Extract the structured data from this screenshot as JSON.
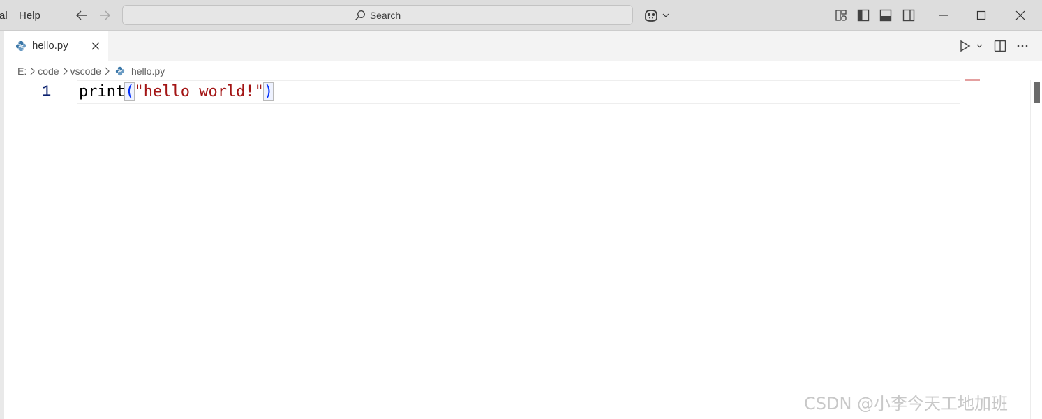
{
  "menu": {
    "partial_label": "al",
    "help_label": "Help"
  },
  "search": {
    "label": "Search"
  },
  "tab": {
    "label": "hello.py"
  },
  "breadcrumb": {
    "items": [
      "E:",
      "code",
      "vscode",
      "hello.py"
    ]
  },
  "editor": {
    "line_number": "1",
    "tokens": {
      "fn": "print",
      "open": "(",
      "str": "\"hello world!\"",
      "close": ")"
    }
  },
  "watermark": {
    "text": "CSDN @小李今天工地加班"
  },
  "colors": {
    "titlebar_bg": "#dddddd",
    "tab_active_bg": "#ffffff",
    "string": "#a31515",
    "bracket": "#0431fa",
    "line_number": "#0b216f"
  },
  "icons": {
    "back": "arrow-left-icon",
    "forward": "arrow-right-icon",
    "search": "search-icon",
    "copilot": "copilot-icon",
    "python": "python-icon",
    "run": "play-icon",
    "split": "split-editor-icon",
    "more": "ellipsis-icon"
  }
}
